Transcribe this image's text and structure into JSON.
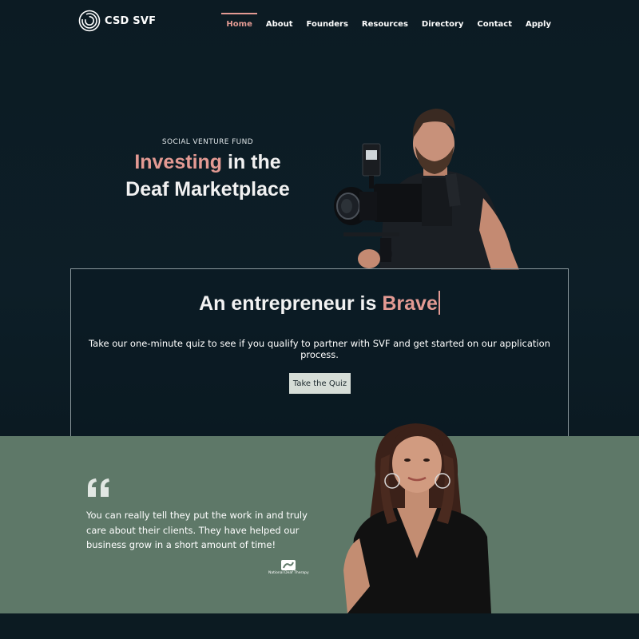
{
  "brand": {
    "name": "CSD SVF"
  },
  "nav": {
    "items": [
      {
        "label": "Home",
        "active": true
      },
      {
        "label": "About"
      },
      {
        "label": "Founders"
      },
      {
        "label": "Resources"
      },
      {
        "label": "Directory"
      },
      {
        "label": "Contact"
      },
      {
        "label": "Apply"
      }
    ]
  },
  "hero": {
    "eyebrow": "SOCIAL VENTURE FUND",
    "headline_accent": "Investing",
    "headline_rest_1": " in the",
    "headline_line2": "Deaf Marketplace"
  },
  "card": {
    "title_prefix": "An entrepreneur is ",
    "title_accent": "Brave",
    "subtitle": "Take our one-minute quiz to see if you qualify to partner with SVF and get started on our application process.",
    "button_label": "Take the Quiz"
  },
  "testimonial": {
    "quote": "You can really tell they put the work in and truly care about their clients. They have helped our business grow in a short amount of time!",
    "partner_name": "National Deaf Therapy"
  },
  "colors": {
    "accent": "#e39a93",
    "background": "#0c1b23",
    "testimonial_bg": "#5e7868",
    "button_bg": "#d6ddd7"
  }
}
